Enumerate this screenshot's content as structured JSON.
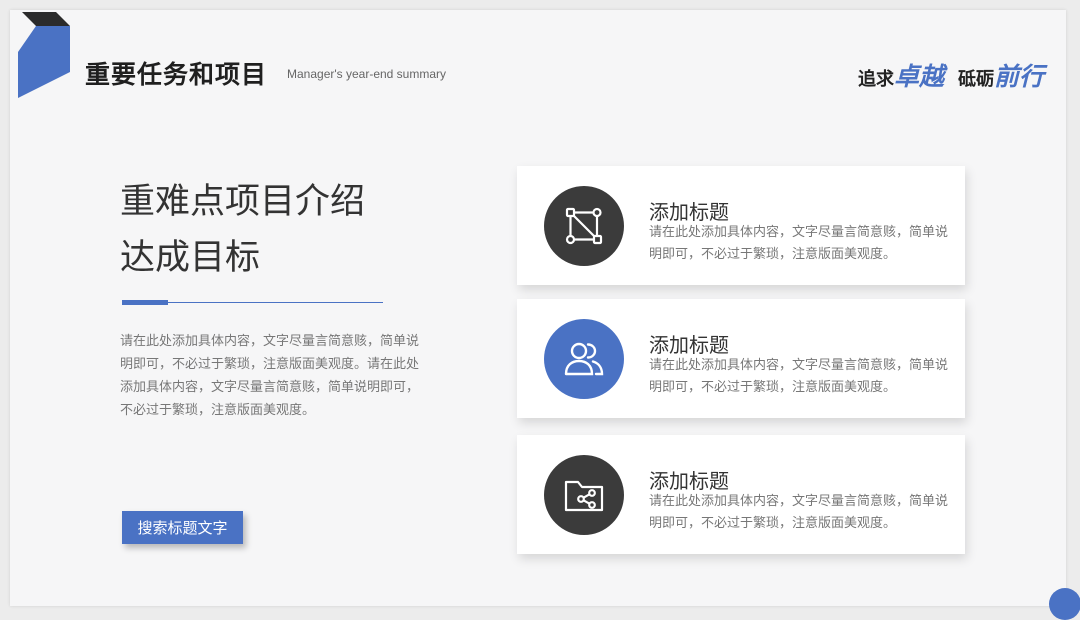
{
  "header": {
    "title": "重要任务和项目",
    "subtitle": "Manager's year-end summary",
    "slogan": [
      {
        "text": "追求",
        "style": "dark"
      },
      {
        "text": "卓越",
        "style": "accent"
      },
      {
        "text": "砥砺",
        "style": "dark"
      },
      {
        "text": "前行",
        "style": "accent"
      }
    ]
  },
  "main": {
    "title_line1": "重难点项目介绍",
    "title_line2": "达成目标",
    "paragraph": "请在此处添加具体内容，文字尽量言简意赅，简单说明即可，不必过于繁琐，注意版面美观度。请在此处添加具体内容，文字尽量言简意赅，简单说明即可，不必过于繁琐，注意版面美观度。",
    "button_label": "搜索标题文字"
  },
  "cards": [
    {
      "title": "添加标题",
      "desc": "请在此处添加具体内容，文字尽量言简意赅，简单说明即可，不必过于繁琐，注意版面美观度。",
      "icon": "node-graph-icon",
      "variant": "dark"
    },
    {
      "title": "添加标题",
      "desc": "请在此处添加具体内容，文字尽量言简意赅，简单说明即可，不必过于繁琐，注意版面美观度。",
      "icon": "users-icon",
      "variant": "blue"
    },
    {
      "title": "添加标题",
      "desc": "请在此处添加具体内容，文字尽量言简意赅，简单说明即可，不必过于繁琐，注意版面美观度。",
      "icon": "folder-share-icon",
      "variant": "dark"
    }
  ],
  "colors": {
    "accent": "#4a72c4",
    "dark": "#3b3b3b",
    "background": "#f6f6f7"
  }
}
